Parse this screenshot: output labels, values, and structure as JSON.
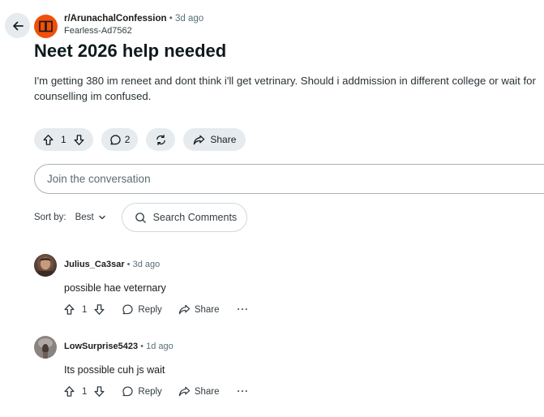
{
  "header": {
    "subreddit": "r/ArunachalConfession",
    "separator": "•",
    "time_ago": "3d ago",
    "author": "Fearless-Ad7562",
    "back_icon": "arrow-left-icon",
    "subreddit_icon": "book-icon",
    "brand_color": "#f14f0a"
  },
  "post": {
    "title": "Neet 2026 help needed",
    "body": "I'm getting 380 im reneet and dont think i'll get vetrinary. Should i addmission in different college or wait for counselling im confused.",
    "votes": "1",
    "comments_count": "2",
    "share_label": "Share"
  },
  "join": {
    "placeholder": "Join the conversation"
  },
  "sort": {
    "label": "Sort by:",
    "value": "Best",
    "search_placeholder": "Search Comments"
  },
  "comments": [
    {
      "user": "Julius_Ca3sar",
      "time_ago": "3d ago",
      "text": "possible hae veternary",
      "votes": "1",
      "reply_label": "Reply",
      "share_label": "Share",
      "more_label": "···"
    },
    {
      "user": "LowSurprise5423",
      "time_ago": "1d ago",
      "text": "Its possible cuh js wait",
      "votes": "1",
      "reply_label": "Reply",
      "share_label": "Share",
      "more_label": "···"
    }
  ]
}
